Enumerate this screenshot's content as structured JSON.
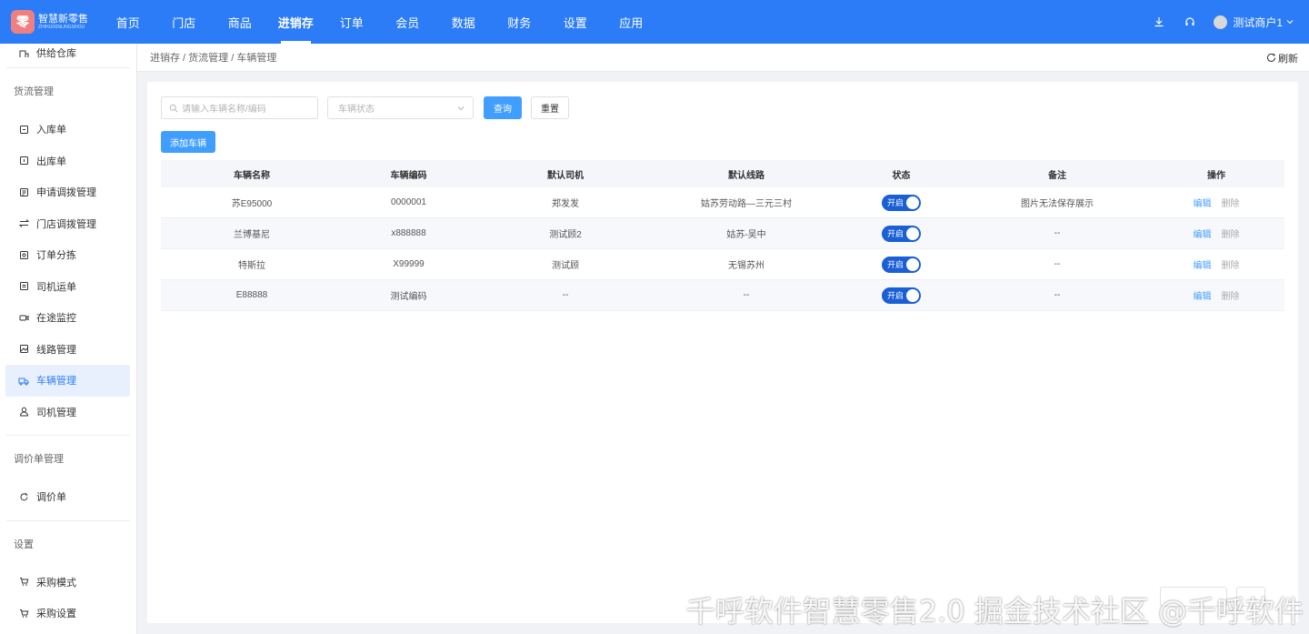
{
  "app": {
    "logo_mark": "零",
    "logo_text": "智慧新零售",
    "logo_subtext": "ZHIHUIXINLINGSHOU"
  },
  "nav": {
    "items": [
      {
        "label": "首页"
      },
      {
        "label": "门店"
      },
      {
        "label": "商品"
      },
      {
        "label": "进销存",
        "active": true
      },
      {
        "label": "订单"
      },
      {
        "label": "会员"
      },
      {
        "label": "数据"
      },
      {
        "label": "财务"
      },
      {
        "label": "设置"
      },
      {
        "label": "应用"
      }
    ],
    "user_name": "测试商户1"
  },
  "sidebar": {
    "top_item": "供给仓库",
    "section1": "货流管理",
    "items": [
      {
        "label": "入库单",
        "icon": "inbound-icon"
      },
      {
        "label": "出库单",
        "icon": "outbound-icon"
      },
      {
        "label": "申请调拨管理",
        "icon": "form-icon"
      },
      {
        "label": "门店调拨管理",
        "icon": "swap-icon"
      },
      {
        "label": "订单分拣",
        "icon": "image-icon"
      },
      {
        "label": "司机运单",
        "icon": "document-icon"
      },
      {
        "label": "在途监控",
        "icon": "video-icon"
      },
      {
        "label": "线路管理",
        "icon": "route-icon"
      },
      {
        "label": "车辆管理",
        "icon": "truck-icon",
        "active": true
      },
      {
        "label": "司机管理",
        "icon": "user-icon"
      }
    ],
    "section2": "调价单管理",
    "items2": [
      {
        "label": "调价单",
        "icon": "refresh-icon"
      }
    ],
    "section3": "设置",
    "items3": [
      {
        "label": "采购模式",
        "icon": "cart-icon"
      },
      {
        "label": "采购设置",
        "icon": "cart-settings-icon"
      }
    ]
  },
  "breadcrumb": "进销存 / 货流管理 / 车辆管理",
  "refresh_label": "刷新",
  "filters": {
    "search_placeholder": "请输入车辆名称/编码",
    "status_placeholder": "车辆状态",
    "query_label": "查询",
    "reset_label": "重置",
    "add_label": "添加车辆"
  },
  "table": {
    "headers": [
      "车辆名称",
      "车辆编码",
      "默认司机",
      "默认线路",
      "状态",
      "备注",
      "操作"
    ],
    "toggle_label": "开启",
    "edit_label": "编辑",
    "delete_label": "删除",
    "rows": [
      {
        "name": "苏E95000",
        "code": "0000001",
        "driver": "郑发发",
        "route": "姑苏劳动路—三元三村",
        "status": "开启",
        "remark": "图片无法保存展示"
      },
      {
        "name": "兰博基尼",
        "code": "x888888",
        "driver": "测试顾2",
        "route": "姑苏-吴中",
        "status": "开启",
        "remark": "--"
      },
      {
        "name": "特斯拉",
        "code": "X99999",
        "driver": "测试顾",
        "route": "无锡苏州",
        "status": "开启",
        "remark": "--"
      },
      {
        "name": "E88888",
        "code": "测试编码",
        "driver": "--",
        "route": "--",
        "status": "开启",
        "remark": "--"
      }
    ]
  },
  "watermark": "千呼软件智慧零售2.0 掘金技术社区 @千呼软件"
}
